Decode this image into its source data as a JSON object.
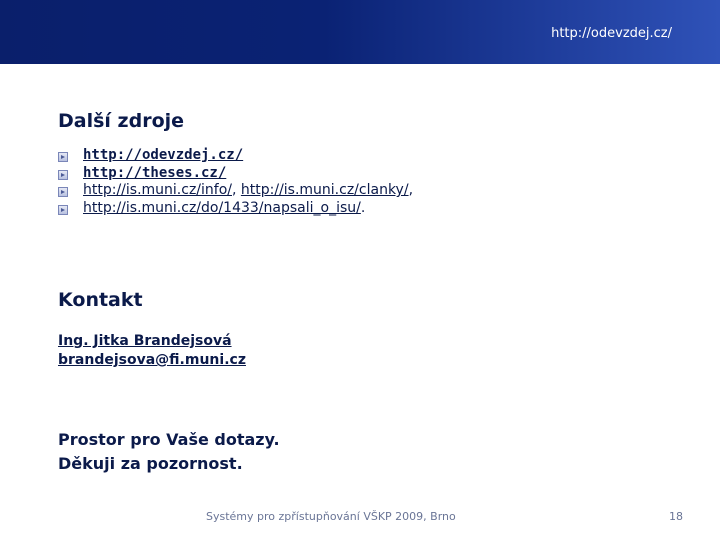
{
  "header": {
    "url": "http://odevzdej.cz/"
  },
  "sources": {
    "title": "Další zdroje",
    "items": [
      {
        "parts": [
          {
            "text": "http://odevzdej.cz/",
            "link": true
          }
        ]
      },
      {
        "parts": [
          {
            "text": "http://theses.cz/",
            "link": true
          }
        ]
      },
      {
        "parts": [
          {
            "text": "http://is.muni.cz/info/",
            "link": true
          },
          {
            "text": ", ",
            "link": false
          },
          {
            "text": "http://is.muni.cz/clanky/",
            "link": true
          },
          {
            "text": ",",
            "link": false
          }
        ]
      },
      {
        "parts": [
          {
            "text": "http://is.muni.cz/do/1433/napsali_o_isu/",
            "link": true
          },
          {
            "text": ".",
            "link": false
          }
        ]
      }
    ]
  },
  "contact": {
    "title": "Kontakt",
    "name": "Ing. Jitka Brandejsová",
    "email": "brandejsova@fi.muni.cz"
  },
  "closing": {
    "line1": "Prostor pro Vaše dotazy.",
    "line2": "Děkuji za pozornost."
  },
  "footer": {
    "text": "Systémy pro zpřístupňování VŠKP 2009, Brno",
    "page": "18"
  }
}
